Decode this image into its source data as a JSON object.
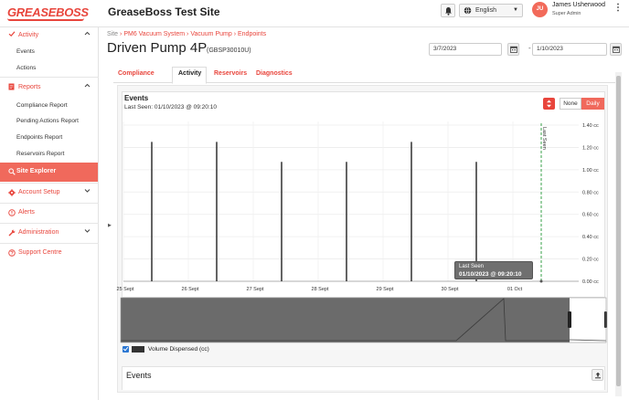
{
  "header": {
    "logo_text": "GREASEBOSS",
    "site_title": "GreaseBoss Test Site",
    "language": "English",
    "user_initials": "JU",
    "user_name": "James Usherwood",
    "user_role": "Super Admin"
  },
  "sidebar": {
    "activity": {
      "label": "Activity",
      "items": [
        "Events",
        "Actions"
      ]
    },
    "reports": {
      "label": "Reports",
      "items": [
        "Compliance Report",
        "Pending Actions Report",
        "Endpoints Report",
        "Reservoirs Report"
      ]
    },
    "site_explorer": "Site Explorer",
    "account_setup": "Account Setup",
    "alerts": "Alerts",
    "administration": "Administration",
    "support_centre": "Support Centre"
  },
  "breadcrumb": {
    "site": "Site",
    "sep": "›",
    "items": [
      "PM6 Vacuum System",
      "Vacuum Pump",
      "Endpoints"
    ]
  },
  "page": {
    "title": "Driven Pump 4P",
    "code": "(GBSP30010U)",
    "start_date": "3/7/2023",
    "end_date": "1/10/2023",
    "date_sep": "-"
  },
  "tabs": [
    "Compliance",
    "Activity",
    "Reservoirs",
    "Diagnostics"
  ],
  "events_panel": {
    "title": "Events",
    "last_seen": "Last Seen: 01/10/2023 @ 09:20:10",
    "toggle_none": "None",
    "toggle_daily": "Daily",
    "marker_label": "Last Seen",
    "tooltip_title": "Last Seen",
    "tooltip_value": "01/10/2023 @ 09:20:10",
    "legend_label": "Volume Dispensed (cc)"
  },
  "events_table": {
    "title": "Events"
  },
  "chart_data": {
    "type": "bar",
    "x_ticks": [
      "25 Sept",
      "26 Sept",
      "27 Sept",
      "28 Sept",
      "29 Sept",
      "30 Sept",
      "01 Oct"
    ],
    "y_ticks": [
      "1.40 cc",
      "1.20 cc",
      "1.00 cc",
      "0.80 cc",
      "0.60 cc",
      "0.40 cc",
      "0.20 cc",
      "0.00 cc"
    ],
    "series": [
      {
        "name": "Volume Dispensed (cc)",
        "x": [
          "25 Sept",
          "26 Sept",
          "27 Sept",
          "28 Sept",
          "29 Sept",
          "30 Sept"
        ],
        "values": [
          1.25,
          1.25,
          1.07,
          1.07,
          1.25,
          1.07
        ]
      }
    ],
    "ylim": [
      0,
      1.4
    ],
    "last_seen_marker": "01/10/2023 09:20:10",
    "grid": true,
    "bar_color": "#222222",
    "marker_color": "#3aa14a",
    "navigator_color": "#6b6b6b"
  }
}
